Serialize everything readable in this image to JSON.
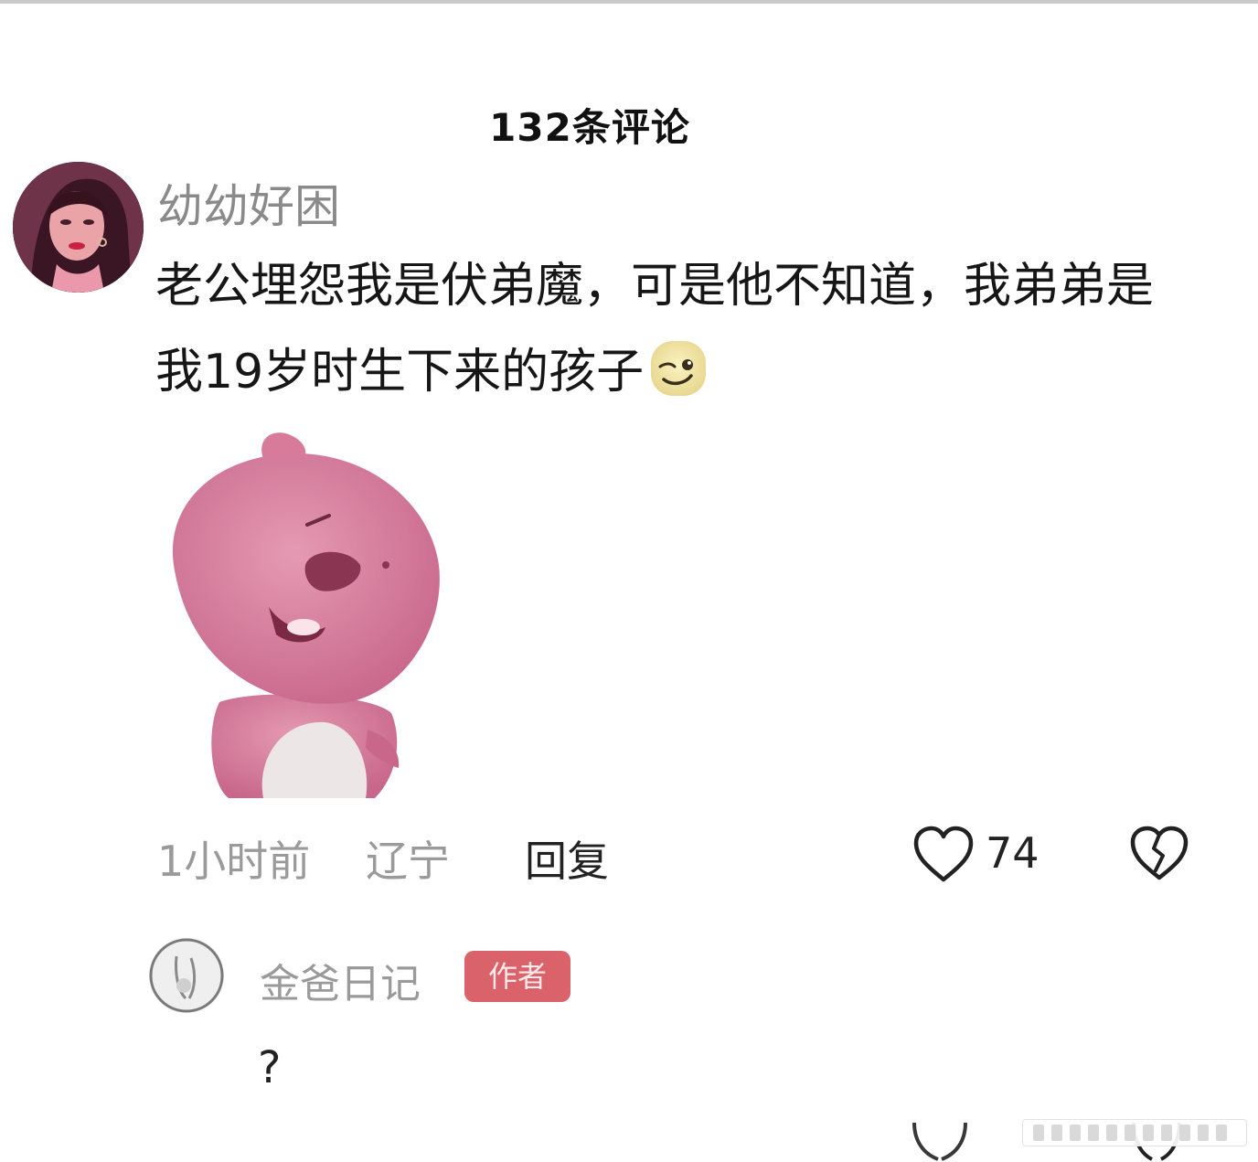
{
  "header": {
    "title": "132条评论"
  },
  "comment": {
    "username": "幼幼好困",
    "text": "老公埋怨我是伏弟魔，可是他不知道，我弟弟是我19岁时生下来的孩子",
    "emoji": "smirk-face-icon",
    "sticker": "pink-dinosaur-sticker",
    "time": "1小时前",
    "location": "辽宁",
    "reply_label": "回复",
    "like_count": "74"
  },
  "reply": {
    "username": "金爸日记",
    "badge": "作者",
    "text": "?"
  },
  "colors": {
    "badge_bg": "#d9626b",
    "meta_text": "#9a9a9a",
    "sticker_pink": "#d87b9a"
  }
}
